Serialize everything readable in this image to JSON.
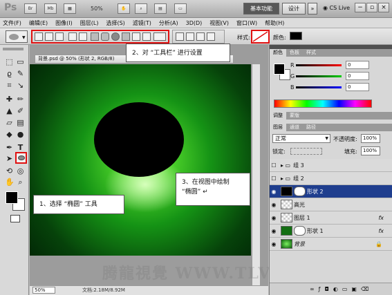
{
  "app": {
    "logo": "Ps",
    "zoom": "50%",
    "workspace_active": "基本功能",
    "workspace_design": "设计",
    "cs_live": "CS Live"
  },
  "window_controls": {
    "minimize": "−",
    "restore": "▫",
    "close": "×"
  },
  "menu": [
    "文件(F)",
    "编辑(E)",
    "图像(I)",
    "图层(L)",
    "选择(S)",
    "滤镜(T)",
    "分析(A)",
    "3D(D)",
    "视图(V)",
    "窗口(W)",
    "帮助(H)"
  ],
  "options_bar": {
    "style_label": "样式:",
    "color_label": "颜色:",
    "color_value": "#000000"
  },
  "document": {
    "tab_title": "背景.psd @ 50% (形状 2, RGB/8)",
    "zoom": "50%",
    "doc_info": "文档:2.18M/8.92M"
  },
  "callouts": {
    "step1": "1、选择 “椭圆” 工具",
    "step2": "2、对 “工具栏” 进行设置",
    "step3_line1": "3、在视图中绘制",
    "step3_line2": "“椭圆” ↵"
  },
  "watermark": "腾龍視覺 WWW.TLVI.NET",
  "color_panel": {
    "tabs": [
      "颜色",
      "色板",
      "样式"
    ],
    "channels": [
      {
        "label": "R",
        "value": "0",
        "color": "#d01010"
      },
      {
        "label": "G",
        "value": "0",
        "color": "#10a010"
      },
      {
        "label": "B",
        "value": "0",
        "color": "#1010d0"
      }
    ]
  },
  "adjust_panel": {
    "tabs": [
      "调整",
      "蒙版"
    ]
  },
  "layers_panel": {
    "tabs": [
      "图层",
      "通道",
      "路径"
    ],
    "blend_mode": "正常",
    "opacity_label": "不透明度:",
    "opacity": "100%",
    "lock_label": "锁定:",
    "fill_label": "填充:",
    "fill": "100%",
    "layers": [
      {
        "name": "组 3",
        "type": "group",
        "visible": false
      },
      {
        "name": "组 2",
        "type": "group",
        "visible": false
      },
      {
        "name": "形状 2",
        "type": "shape",
        "visible": true,
        "selected": true,
        "fx": ""
      },
      {
        "name": "高光",
        "type": "pixel",
        "visible": true,
        "fx": ""
      },
      {
        "name": "图层 1",
        "type": "pixel",
        "visible": true,
        "fx": "fx"
      },
      {
        "name": "形状 1",
        "type": "shape",
        "visible": true,
        "fx": "fx"
      },
      {
        "name": "背景",
        "type": "background",
        "visible": true,
        "fx": ""
      }
    ]
  }
}
